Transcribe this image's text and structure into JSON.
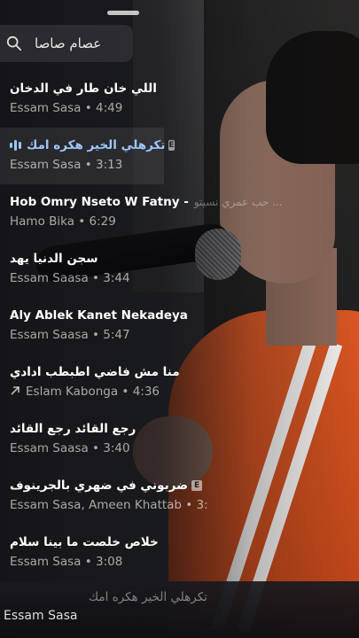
{
  "search": {
    "query": "عصام صاصا"
  },
  "tracks": [
    {
      "title": "اللي خان طار في الدخان",
      "subtitle": "Essam Sasa • 4:49",
      "explicit": false,
      "playing": false,
      "remix": false
    },
    {
      "title": "تكرهلي الخير هكره امك",
      "subtitle": "Essam Sasa • 3:13",
      "explicit": true,
      "playing": true,
      "remix": false
    },
    {
      "title": "Hob Omry Nseto W Fatny - ",
      "title_extra": "حب عمري نسيتو ...",
      "subtitle": "Hamo Bika • 6:29",
      "explicit": false,
      "playing": false,
      "remix": false
    },
    {
      "title": "سجن الدنيا يهد",
      "subtitle": "Essam Saasa • 3:44",
      "explicit": false,
      "playing": false,
      "remix": false
    },
    {
      "title": "Aly Ablek Kanet Nekadeya",
      "subtitle": "Essam Saasa • 5:47",
      "explicit": false,
      "playing": false,
      "remix": false
    },
    {
      "title": "منا مش فاضي اطبطب ادادي",
      "subtitle": "Eslam Kabonga • 4:36",
      "explicit": false,
      "playing": false,
      "remix": true
    },
    {
      "title": "رجع القائد رجع القائد",
      "subtitle": "Essam Saasa • 3:40",
      "explicit": false,
      "playing": false,
      "remix": false
    },
    {
      "title": "ضربوني في ضهري بالجرينوف",
      "subtitle": "Essam Sasa, Ameen Khattab • 3:",
      "explicit": true,
      "playing": false,
      "remix": false
    },
    {
      "title": "خلاص خلصت ما بينا سلام",
      "subtitle": "Essam Sasa • 3:08",
      "explicit": false,
      "playing": false,
      "remix": false
    }
  ],
  "badge_letter": "E",
  "now_playing": {
    "title": "تكرهلي الخير هكره امك",
    "artist": "Essam Sasa"
  },
  "colors": {
    "accent": "#9fc6ff",
    "jacket": "#e05b25"
  }
}
